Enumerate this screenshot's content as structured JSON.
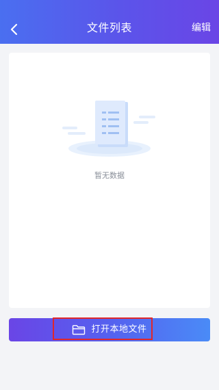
{
  "header": {
    "back_icon": "chevron-left-icon",
    "title": "文件列表",
    "edit_label": "编辑",
    "gradient_colors": [
      "#4a6ff0",
      "#5b54ea",
      "#6a45e6"
    ]
  },
  "empty_state": {
    "illustration_icon": "empty-document-icon",
    "message": "暂无数据"
  },
  "open_button": {
    "icon": "folder-icon",
    "label": "打开本地文件",
    "gradient_colors": [
      "#6a45e6",
      "#5561ef",
      "#4a8bf7"
    ],
    "highlight_color": "#e0262a"
  }
}
